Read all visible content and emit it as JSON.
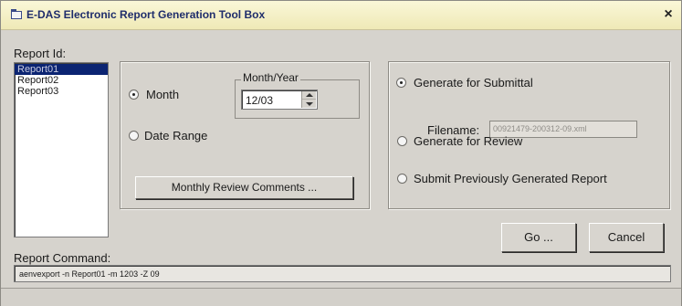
{
  "window": {
    "title": "E-DAS Electronic Report Generation Tool Box",
    "close_glyph": "×"
  },
  "report_id": {
    "label": "Report Id:",
    "items": [
      "Report01",
      "Report02",
      "Report03"
    ],
    "selected": "Report01"
  },
  "period": {
    "month_label": "Month",
    "month_selected": true,
    "month_year_label": "Month/Year",
    "month_year_value": "12/03",
    "date_range_label": "Date Range",
    "date_range_selected": false,
    "comments_button": "Monthly Review Comments ..."
  },
  "generate": {
    "submittal_label": "Generate for Submittal",
    "submittal_selected": true,
    "filename_label": "Filename:",
    "filename_value": "00921479-200312-09.xml",
    "review_label": "Generate for Review",
    "review_selected": false,
    "submit_prev_label": "Submit Previously Generated Report",
    "submit_prev_selected": false
  },
  "actions": {
    "go_label": "Go ...",
    "cancel_label": "Cancel"
  },
  "command": {
    "label": "Report Command:",
    "value": "aenvexport -n Report01 -m 1203 -Z 09"
  },
  "icons": {
    "app": "window-icon",
    "spin_up": "arrow-up-icon",
    "spin_down": "arrow-down-icon"
  }
}
